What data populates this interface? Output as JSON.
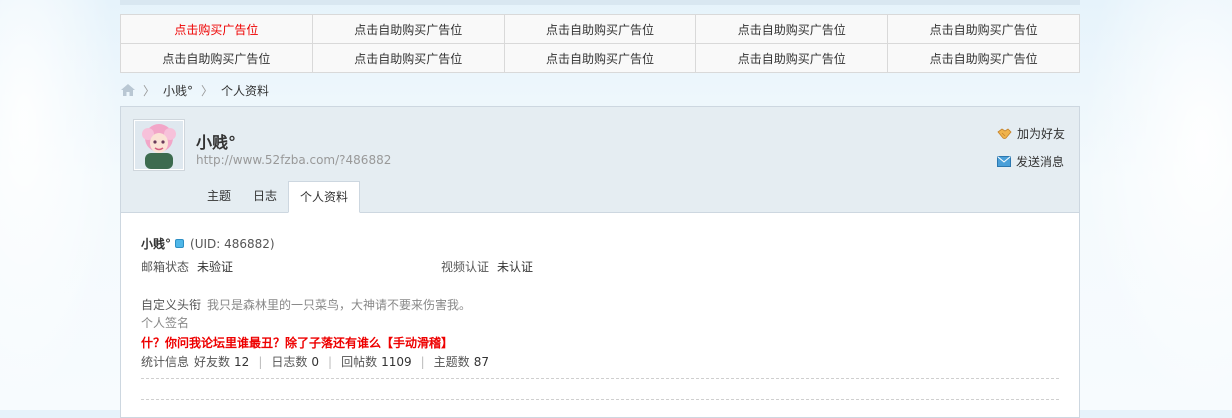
{
  "ads": {
    "row1": [
      "点击购买广告位",
      "点击自助购买广告位",
      "点击自助购买广告位",
      "点击自助购买广告位",
      "点击自助购买广告位"
    ],
    "row2": [
      "点击自助购买广告位",
      "点击自助购买广告位",
      "点击自助购买广告位",
      "点击自助购买广告位",
      "点击自助购买广告位"
    ]
  },
  "breadcrumb": {
    "sep": "〉",
    "user": "小贱°",
    "page": "个人资料"
  },
  "profile": {
    "username": "小贱°",
    "url": "http://www.52fzba.com/?486882",
    "actions": {
      "add_friend": "加为好友",
      "send_message": "发送消息"
    },
    "tabs": [
      "主题",
      "日志",
      "个人资料"
    ],
    "active_tab": "个人资料"
  },
  "details": {
    "name": "小贱°",
    "uid": "(UID: 486882)",
    "email_status_label": "邮箱状态",
    "email_status_value": "未验证",
    "video_label": "视频认证",
    "video_value": "未认证",
    "custom_title_label": "自定义头衔",
    "custom_title_value": "我只是森林里的一只菜鸟，大神请不要来伤害我。",
    "signature_label": "个人签名",
    "signature_value": "什？你问我论坛里谁最丑？除了子落还有谁么【手动滑稽】",
    "stats_label": "统计信息",
    "friends_label": "好友数",
    "friends": "12",
    "blogs_label": "日志数",
    "blogs": "0",
    "replies_label": "回帖数",
    "replies": "1109",
    "threads_label": "主题数",
    "threads": "87",
    "stat_divider": "|"
  },
  "colors": {
    "ad_hot": "#ee0000",
    "signature": "#ee0000",
    "header_bg": "#e5edf2"
  }
}
